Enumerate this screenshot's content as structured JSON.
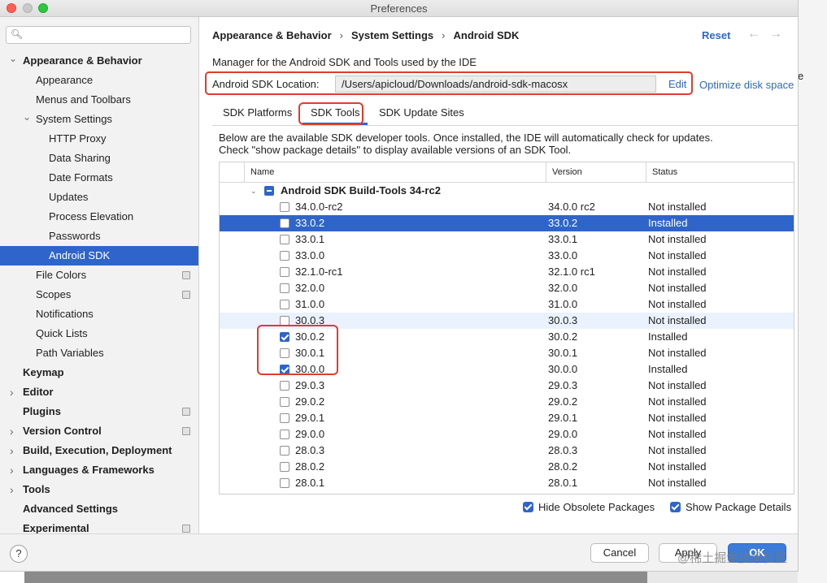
{
  "window": {
    "title": "Preferences"
  },
  "search": {
    "placeholder": ""
  },
  "sidebar": {
    "items": [
      {
        "label": "Appearance & Behavior"
      },
      {
        "label": "Appearance"
      },
      {
        "label": "Menus and Toolbars"
      },
      {
        "label": "System Settings"
      },
      {
        "label": "HTTP Proxy"
      },
      {
        "label": "Data Sharing"
      },
      {
        "label": "Date Formats"
      },
      {
        "label": "Updates"
      },
      {
        "label": "Process Elevation"
      },
      {
        "label": "Passwords"
      },
      {
        "label": "Android SDK"
      },
      {
        "label": "File Colors"
      },
      {
        "label": "Scopes"
      },
      {
        "label": "Notifications"
      },
      {
        "label": "Quick Lists"
      },
      {
        "label": "Path Variables"
      },
      {
        "label": "Keymap"
      },
      {
        "label": "Editor"
      },
      {
        "label": "Plugins"
      },
      {
        "label": "Version Control"
      },
      {
        "label": "Build, Execution, Deployment"
      },
      {
        "label": "Languages & Frameworks"
      },
      {
        "label": "Tools"
      },
      {
        "label": "Advanced Settings"
      },
      {
        "label": "Experimental"
      }
    ]
  },
  "breadcrumb": [
    "Appearance & Behavior",
    "System Settings",
    "Android SDK"
  ],
  "header": {
    "reset": "Reset"
  },
  "main": {
    "description": "Manager for the Android SDK and Tools used by the IDE",
    "sdk_location_label": "Android SDK Location:",
    "sdk_location_value": "/Users/apicloud/Downloads/android-sdk-macosx",
    "edit": "Edit",
    "optimize": "Optimize disk space",
    "tabs": [
      {
        "label": "SDK Platforms"
      },
      {
        "label": "SDK Tools"
      },
      {
        "label": "SDK Update Sites"
      }
    ],
    "info_text": "Below are the available SDK developer tools. Once installed, the IDE will automatically check for updates. Check \"show package details\" to display available versions of an SDK Tool."
  },
  "table": {
    "columns": [
      "Name",
      "Version",
      "Status"
    ],
    "group": "Android SDK Build-Tools 34-rc2",
    "rows": [
      {
        "name": "34.0.0-rc2",
        "version": "34.0.0 rc2",
        "status": "Not installed",
        "checked": false
      },
      {
        "name": "33.0.2",
        "version": "33.0.2",
        "status": "Installed",
        "checked": false
      },
      {
        "name": "33.0.1",
        "version": "33.0.1",
        "status": "Not installed",
        "checked": false
      },
      {
        "name": "33.0.0",
        "version": "33.0.0",
        "status": "Not installed",
        "checked": false
      },
      {
        "name": "32.1.0-rc1",
        "version": "32.1.0 rc1",
        "status": "Not installed",
        "checked": false
      },
      {
        "name": "32.0.0",
        "version": "32.0.0",
        "status": "Not installed",
        "checked": false
      },
      {
        "name": "31.0.0",
        "version": "31.0.0",
        "status": "Not installed",
        "checked": false
      },
      {
        "name": "30.0.3",
        "version": "30.0.3",
        "status": "Not installed",
        "checked": false
      },
      {
        "name": "30.0.2",
        "version": "30.0.2",
        "status": "Installed",
        "checked": true
      },
      {
        "name": "30.0.1",
        "version": "30.0.1",
        "status": "Not installed",
        "checked": false
      },
      {
        "name": "30.0.0",
        "version": "30.0.0",
        "status": "Installed",
        "checked": true
      },
      {
        "name": "29.0.3",
        "version": "29.0.3",
        "status": "Not installed",
        "checked": false
      },
      {
        "name": "29.0.2",
        "version": "29.0.2",
        "status": "Not installed",
        "checked": false
      },
      {
        "name": "29.0.1",
        "version": "29.0.1",
        "status": "Not installed",
        "checked": false
      },
      {
        "name": "29.0.0",
        "version": "29.0.0",
        "status": "Not installed",
        "checked": false
      },
      {
        "name": "28.0.3",
        "version": "28.0.3",
        "status": "Not installed",
        "checked": false
      },
      {
        "name": "28.0.2",
        "version": "28.0.2",
        "status": "Not installed",
        "checked": false
      },
      {
        "name": "28.0.1",
        "version": "28.0.1",
        "status": "Not installed",
        "checked": false
      }
    ]
  },
  "options": {
    "hide_obsolete": "Hide Obsolete Packages",
    "show_details": "Show Package Details"
  },
  "footer": {
    "help": "?",
    "cancel": "Cancel",
    "apply": "Apply",
    "ok": "OK"
  },
  "watermark": "@稀土掘金技术社区",
  "colors": {
    "accent": "#2f65ca",
    "highlight_border": "#e23b2c"
  }
}
